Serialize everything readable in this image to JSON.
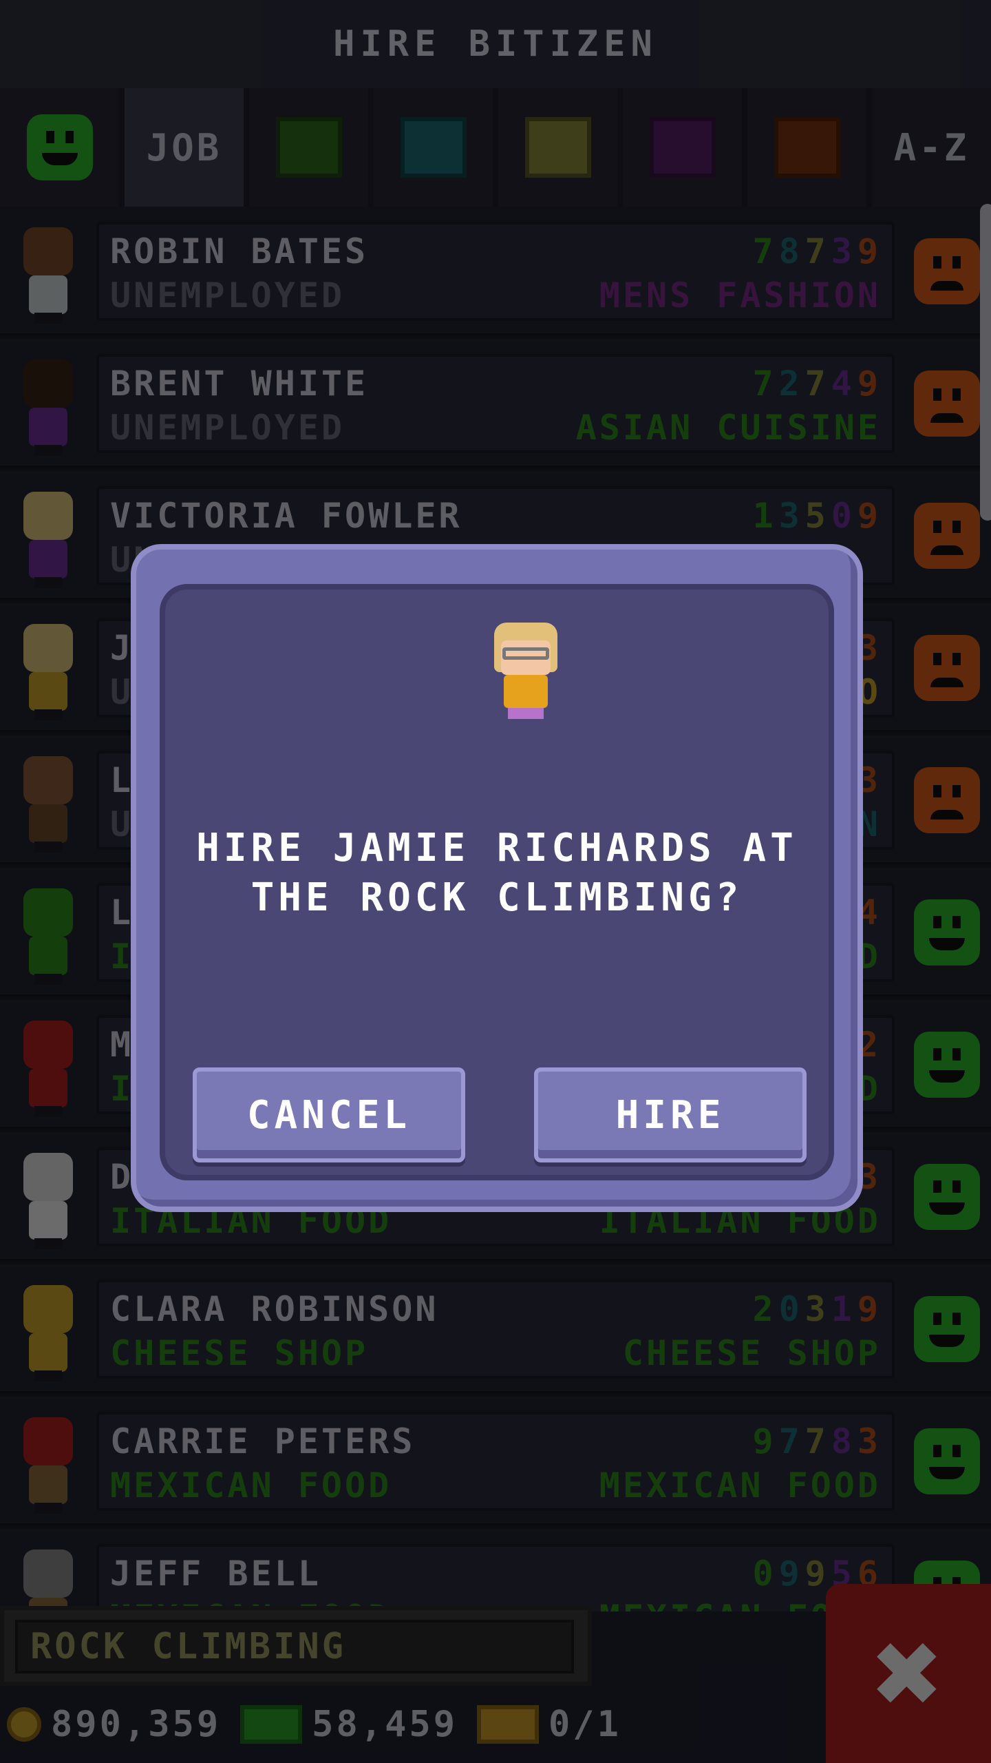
{
  "header": {
    "title": "HIRE BITIZEN"
  },
  "tabs": [
    {
      "kind": "smile",
      "label": ""
    },
    {
      "kind": "text",
      "label": "JOB"
    },
    {
      "kind": "swatch",
      "color": "#2f6a1e"
    },
    {
      "kind": "swatch",
      "color": "#1c6a72"
    },
    {
      "kind": "swatch",
      "color": "#8a8a3a"
    },
    {
      "kind": "swatch",
      "color": "#5a1f66"
    },
    {
      "kind": "swatch",
      "color": "#7a3512"
    },
    {
      "kind": "text",
      "label": "A-Z"
    }
  ],
  "rows": [
    {
      "name": "ROBIN BATES",
      "job": "UNEMPLOYED",
      "job_color": "#6b6b7c",
      "skills": [
        "7",
        "8",
        "7",
        "3",
        "9"
      ],
      "dream": "MENS FASHION",
      "dream_color": "#7b2a8a",
      "mood": "unhappy",
      "hair": "#7a4a2a",
      "body": "#cfd6d6"
    },
    {
      "name": "BRENT WHITE",
      "job": "UNEMPLOYED",
      "job_color": "#6b6b7c",
      "skills": [
        "7",
        "2",
        "7",
        "4",
        "9"
      ],
      "dream": "ASIAN CUISINE",
      "dream_color": "#2f8a1e",
      "mood": "unhappy",
      "hair": "#3a2418",
      "body": "#6a2f9a"
    },
    {
      "name": "VICTORIA FOWLER",
      "job": "UNEMPLOYED",
      "job_color": "#6b6b7c",
      "skills": [
        "1",
        "3",
        "5",
        "0",
        "9"
      ],
      "dream": "",
      "dream_color": "#c9a22c",
      "mood": "unhappy",
      "hair": "#d9c27a",
      "body": "#6a2f9a"
    },
    {
      "name": "J",
      "job": "U",
      "job_color": "#6b6b7c",
      "skills": [
        "3"
      ],
      "dream": "O",
      "dream_color": "#c9a22c",
      "mood": "unhappy",
      "hair": "#d9c27a",
      "body": "#c9a22c"
    },
    {
      "name": "L",
      "job": "U",
      "job_color": "#6b6b7c",
      "skills": [
        "3"
      ],
      "dream": "N",
      "dream_color": "#1c6a72",
      "mood": "unhappy",
      "hair": "#8a5a3a",
      "body": "#6a4a2a"
    },
    {
      "name": "L",
      "job": "IT",
      "job_color": "#2f8a1e",
      "skills": [
        "4"
      ],
      "dream": "D",
      "dream_color": "#2f8a1e",
      "mood": "happy",
      "hair": "#2f8a1e",
      "body": "#2f8a1e"
    },
    {
      "name": "M",
      "job": "IT",
      "job_color": "#2f8a1e",
      "skills": [
        "2"
      ],
      "dream": "D",
      "dream_color": "#2f8a1e",
      "mood": "happy",
      "hair": "#b01f1f",
      "body": "#b01f1f"
    },
    {
      "name": "D",
      "job": "ITALIAN FOOD",
      "job_color": "#2f8a1e",
      "skills": [
        "3"
      ],
      "dream": "ITALIAN FOOD",
      "dream_color": "#2f8a1e",
      "mood": "happy",
      "hair": "#dddddd",
      "body": "#eeeeee"
    },
    {
      "name": "CLARA ROBINSON",
      "job": "CHEESE SHOP",
      "job_color": "#2f8a1e",
      "skills": [
        "2",
        "0",
        "3",
        "1",
        "9"
      ],
      "dream": "CHEESE SHOP",
      "dream_color": "#2f8a1e",
      "mood": "happy",
      "hair": "#c9a22c",
      "body": "#c9a22c"
    },
    {
      "name": "CARRIE PETERS",
      "job": "MEXICAN FOOD",
      "job_color": "#2f8a1e",
      "skills": [
        "9",
        "7",
        "7",
        "8",
        "3"
      ],
      "dream": "MEXICAN FOOD",
      "dream_color": "#2f8a1e",
      "mood": "happy",
      "hair": "#b01f1f",
      "body": "#8a6a3a"
    },
    {
      "name": "JEFF BELL",
      "job": "MEXICAN FOOD",
      "job_color": "#2f8a1e",
      "skills": [
        "0",
        "9",
        "9",
        "5",
        "6"
      ],
      "dream": "MEXICAN FOOD",
      "dream_color": "#2f8a1e",
      "mood": "happy",
      "hair": "#8a8a8a",
      "body": "#8a6a3a"
    }
  ],
  "skill_colors": [
    "#2f8a1e",
    "#1c6a72",
    "#8a8a3a",
    "#6a2f9a",
    "#b8501c"
  ],
  "business": {
    "name": "ROCK CLIMBING"
  },
  "stats": {
    "coins": "890,359",
    "bux": "58,459",
    "vip": "0/1"
  },
  "dialog": {
    "question": "HIRE JAMIE RICHARDS AT THE ROCK CLIMBING?",
    "cancel_label": "CANCEL",
    "hire_label": "HIRE"
  },
  "close_icon": "✖"
}
